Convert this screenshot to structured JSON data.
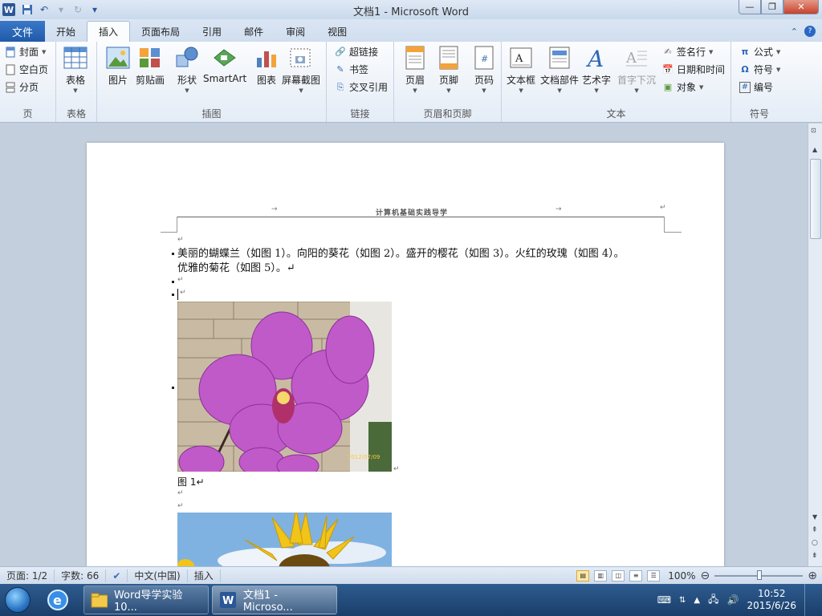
{
  "window": {
    "title": "文档1 - Microsoft Word",
    "app_icon": "W",
    "controls": {
      "minimize": "—",
      "restore": "❐",
      "close": "✕"
    }
  },
  "tabs": {
    "file": "文件",
    "items": [
      "开始",
      "插入",
      "页面布局",
      "引用",
      "邮件",
      "审阅",
      "视图"
    ],
    "active": "插入"
  },
  "ribbon": {
    "pages": {
      "label": "页",
      "items": [
        "封面",
        "空白页",
        "分页"
      ]
    },
    "tables": {
      "label": "表格",
      "table": "表格"
    },
    "illustrations": {
      "label": "插图",
      "picture": "图片",
      "clipart": "剪贴画",
      "shapes": "形状",
      "smartart": "SmartArt",
      "chart": "图表",
      "screenshot": "屏幕截图"
    },
    "links": {
      "label": "链接",
      "items": [
        "超链接",
        "书签",
        "交叉引用"
      ]
    },
    "header_footer": {
      "label": "页眉和页脚",
      "header": "页眉",
      "footer": "页脚",
      "page_number": "页码"
    },
    "text": {
      "label": "文本",
      "textbox": "文本框",
      "quickparts": "文档部件",
      "wordart": "艺术字",
      "dropcap": "首字下沉",
      "signature": "签名行",
      "datetime": "日期和时间",
      "object": "对象"
    },
    "symbols": {
      "label": "符号",
      "equation": "公式",
      "symbol": "符号",
      "number": "编号"
    }
  },
  "document": {
    "header_text": "计算机基础实践导学",
    "paragraph_line1": "美丽的蝴蝶兰（如图 1）。向阳的葵花（如图 2）。盛开的樱花（如图 3）。火红的玫瑰（如图 4）。",
    "paragraph_line2": "优雅的菊花（如图 5）。↵",
    "caption1": "图 1↵",
    "photo1_stamp": "2012/07/09"
  },
  "status": {
    "page": "页面: 1/2",
    "words": "字数: 66",
    "language": "中文(中国)",
    "mode": "插入",
    "zoom": "100%"
  },
  "taskbar": {
    "task1": "Word导学实验10...",
    "task2": "文档1 - Microso...",
    "time": "10:52",
    "date": "2015/6/26"
  }
}
